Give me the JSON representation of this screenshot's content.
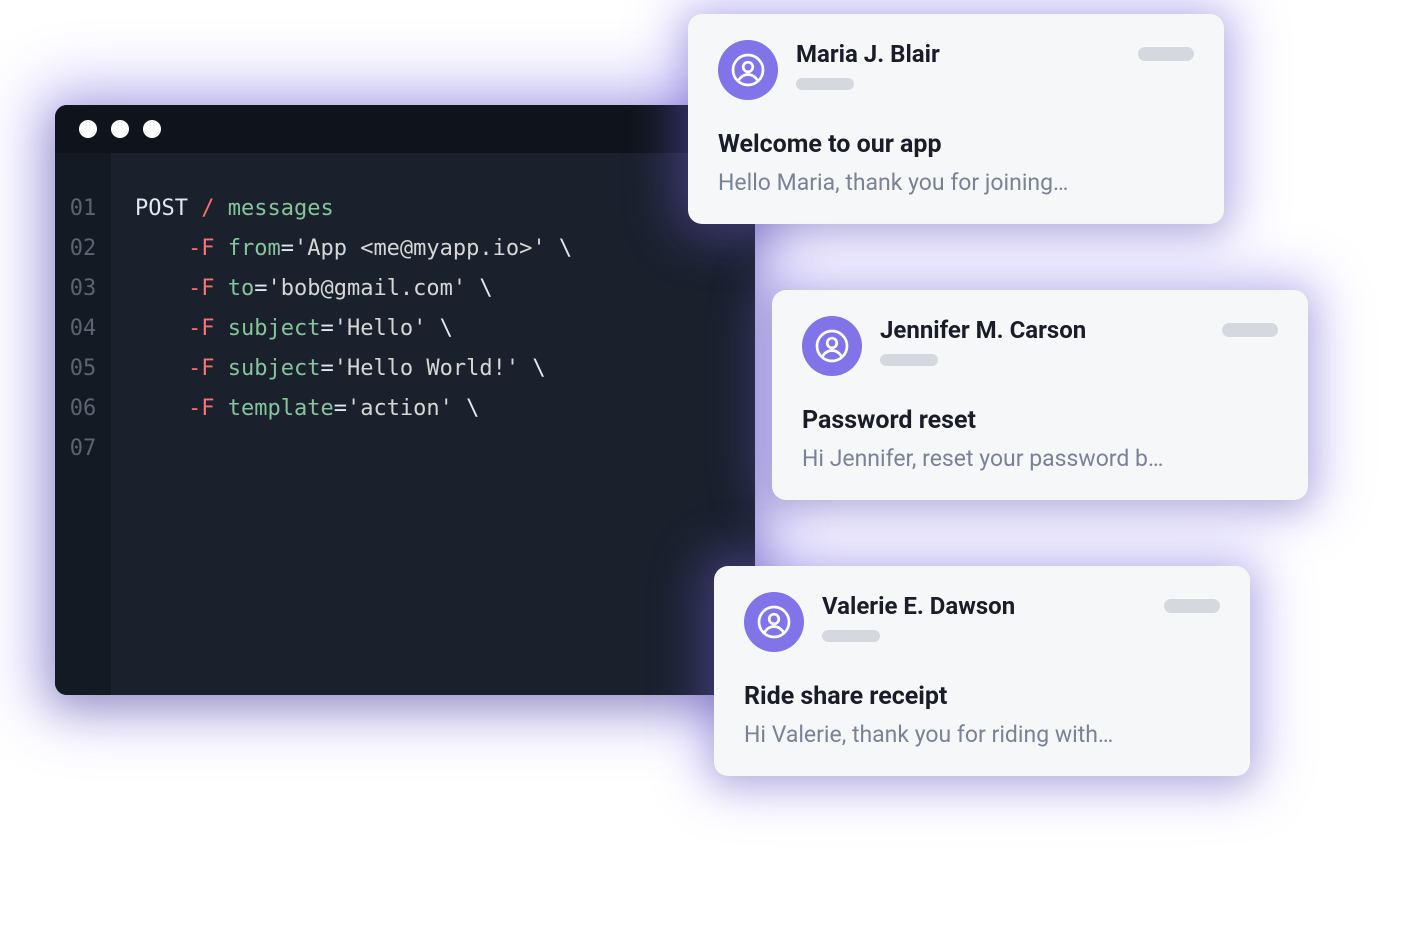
{
  "terminal": {
    "line_numbers": [
      "01",
      "02",
      "03",
      "04",
      "05",
      "06",
      "07"
    ],
    "lines": [
      {
        "indent": 0,
        "tokens": [
          {
            "cls": "tok-white",
            "text": "POST "
          },
          {
            "cls": "tok-red",
            "text": "/"
          },
          {
            "cls": "tok-green",
            "text": " messages"
          }
        ]
      },
      {
        "indent": 1,
        "tokens": [
          {
            "cls": "tok-red",
            "text": "-F "
          },
          {
            "cls": "tok-green",
            "text": "from"
          },
          {
            "cls": "tok-white",
            "text": "="
          },
          {
            "cls": "tok-str",
            "text": "'App <me@myapp.io>'"
          },
          {
            "cls": "tok-slash",
            "text": " \\"
          }
        ]
      },
      {
        "indent": 1,
        "tokens": [
          {
            "cls": "tok-red",
            "text": "-F "
          },
          {
            "cls": "tok-green",
            "text": "to"
          },
          {
            "cls": "tok-white",
            "text": "="
          },
          {
            "cls": "tok-str",
            "text": "'bob@gmail.com'"
          },
          {
            "cls": "tok-slash",
            "text": " \\"
          }
        ]
      },
      {
        "indent": 1,
        "tokens": [
          {
            "cls": "tok-red",
            "text": "-F "
          },
          {
            "cls": "tok-green",
            "text": "subject"
          },
          {
            "cls": "tok-white",
            "text": "="
          },
          {
            "cls": "tok-str",
            "text": "'Hello'"
          },
          {
            "cls": "tok-slash",
            "text": " \\"
          }
        ]
      },
      {
        "indent": 1,
        "tokens": [
          {
            "cls": "tok-red",
            "text": "-F "
          },
          {
            "cls": "tok-green",
            "text": "subject"
          },
          {
            "cls": "tok-white",
            "text": "="
          },
          {
            "cls": "tok-str",
            "text": "'Hello World!'"
          },
          {
            "cls": "tok-slash",
            "text": " \\"
          }
        ]
      },
      {
        "indent": 1,
        "tokens": [
          {
            "cls": "tok-red",
            "text": "-F "
          },
          {
            "cls": "tok-green",
            "text": "template"
          },
          {
            "cls": "tok-white",
            "text": "="
          },
          {
            "cls": "tok-str",
            "text": "'action'"
          },
          {
            "cls": "tok-slash",
            "text": " \\"
          }
        ]
      },
      {
        "indent": 0,
        "tokens": []
      }
    ]
  },
  "messages": [
    {
      "sender": "Maria J. Blair",
      "subject": "Welcome to our app",
      "preview": "Hello Maria, thank you for joining…"
    },
    {
      "sender": "Jennifer M. Carson",
      "subject": "Password reset",
      "preview": "Hi Jennifer, reset your password b…"
    },
    {
      "sender": "Valerie E. Dawson",
      "subject": "Ride share receipt",
      "preview": "Hi Valerie, thank you for riding with…"
    }
  ],
  "colors": {
    "accent": "#8174e8",
    "terminal_bg": "#1a202c"
  }
}
